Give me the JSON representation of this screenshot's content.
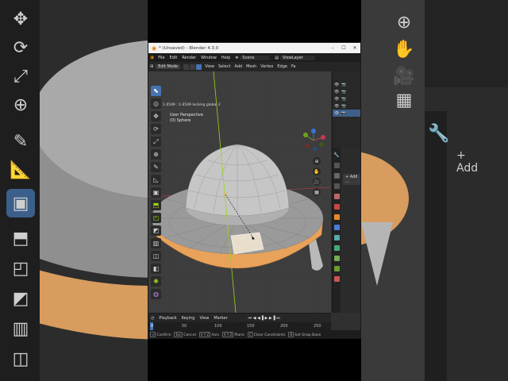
{
  "window": {
    "title": "* (Unsaved) - Blender 4.3.0",
    "minimize": "–",
    "maximize": "☐",
    "close": "✕"
  },
  "menu": {
    "items": [
      "File",
      "Edit",
      "Render",
      "Window",
      "Help"
    ],
    "scene_label": "Scene",
    "view_layer_label": "ViewLayer"
  },
  "header": {
    "mode": "Edit Mode",
    "items": [
      "View",
      "Select",
      "Add",
      "Mesh",
      "Vertex",
      "Edge",
      "Fa"
    ]
  },
  "viewport": {
    "status_text": "Scale: 1.6549 : 1.6549 locking global 2",
    "perspective": "User Perspective",
    "object": "(0) Sphere"
  },
  "timeline": {
    "menu": [
      "Playback",
      "Keying",
      "View",
      "Marker"
    ],
    "frame_current": "0",
    "ticks": [
      "0",
      "50",
      "100",
      "150",
      "200",
      "250"
    ]
  },
  "statusbar": {
    "items": [
      {
        "key": "⏎",
        "label": "Confirm"
      },
      {
        "key": "Esc",
        "label": "Cancel"
      },
      {
        "key": "X Y Z",
        "label": "Axis"
      },
      {
        "key": "X Y Z",
        "label": "Plane"
      },
      {
        "key": "C",
        "label": "Clear Constraints"
      },
      {
        "key": "B",
        "label": "Set Snap Base"
      }
    ]
  },
  "properties": {
    "add_label": "+ Add ..."
  },
  "colors": {
    "accent": "#4772b3",
    "selected_face": "#e8a25a",
    "axis_y": "#9bd31c",
    "axis_x": "#c43b4b",
    "blender_orange": "#e87d0d"
  },
  "icons": {
    "toolbar": [
      "cursor-select-icon",
      "cursor-3d-icon",
      "move-icon",
      "rotate-icon",
      "scale-icon",
      "transform-icon",
      "annotate-icon",
      "measure-icon",
      "add-cube-icon",
      "extrude-icon",
      "inset-icon",
      "bevel-icon",
      "loop-cut-icon",
      "knife-icon",
      "poly-build-icon",
      "spin-icon",
      "smooth-icon",
      "shear-icon",
      "shrink-icon"
    ]
  }
}
